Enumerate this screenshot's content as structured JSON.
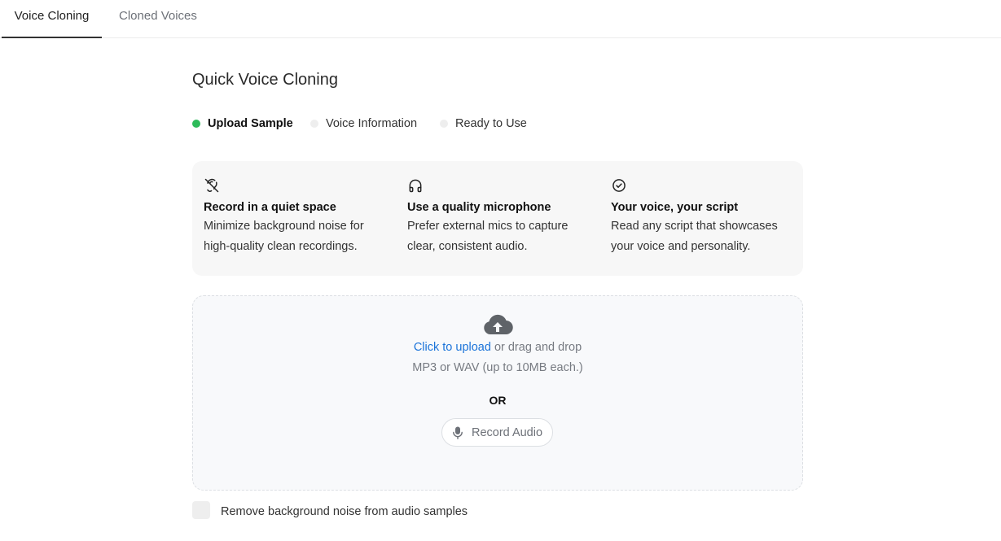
{
  "tabs": [
    {
      "label": "Voice Cloning",
      "active": true
    },
    {
      "label": "Cloned Voices",
      "active": false
    }
  ],
  "page": {
    "title": "Quick Voice Cloning"
  },
  "steps": [
    {
      "label": "Upload Sample",
      "status": "current",
      "color": "#2dbb5a"
    },
    {
      "label": "Voice Information",
      "status": "pending",
      "color": "#eeeeee"
    },
    {
      "label": "Ready to Use",
      "status": "pending",
      "color": "#eeeeee"
    }
  ],
  "tips": [
    {
      "icon": "ear-off-icon",
      "title": "Record in a quiet space",
      "description": "Minimize background noise for high-quality clean recordings."
    },
    {
      "icon": "headphones-icon",
      "title": "Use a quality microphone",
      "description": "Prefer external mics to capture clear, consistent audio."
    },
    {
      "icon": "check-circle-icon",
      "title": "Your voice, your script",
      "description": "Read any script that showcases your voice and personality."
    }
  ],
  "upload": {
    "icon": "cloud-upload-icon",
    "link_label": "Click to upload",
    "drag_text": " or drag and drop",
    "formats": "MP3 or WAV (up to 10MB each.)",
    "or_label": "OR",
    "record_label": "Record Audio",
    "record_icon": "microphone-icon"
  },
  "noise_removal": {
    "label": "Remove background noise from audio samples",
    "checked": false
  },
  "colors": {
    "accent_link": "#1a73d9",
    "step_active": "#2dbb5a"
  }
}
